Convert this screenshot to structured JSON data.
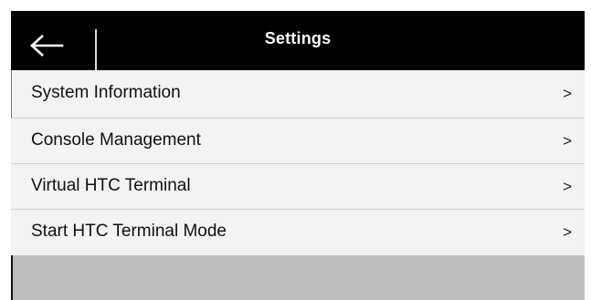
{
  "header": {
    "title": "Settings",
    "back_icon": "arrow-left-icon"
  },
  "menu": {
    "items": [
      {
        "label": "System Information",
        "chevron": ">"
      },
      {
        "label": "Console Management",
        "chevron": ">"
      },
      {
        "label": "Virtual HTC Terminal",
        "chevron": ">"
      },
      {
        "label": "Start HTC Terminal Mode",
        "chevron": ">"
      }
    ]
  },
  "colors": {
    "header_bg": "#000000",
    "header_text": "#ffffff",
    "menu_bg": "#f3f3f3",
    "footer_bg": "#bebebe"
  }
}
